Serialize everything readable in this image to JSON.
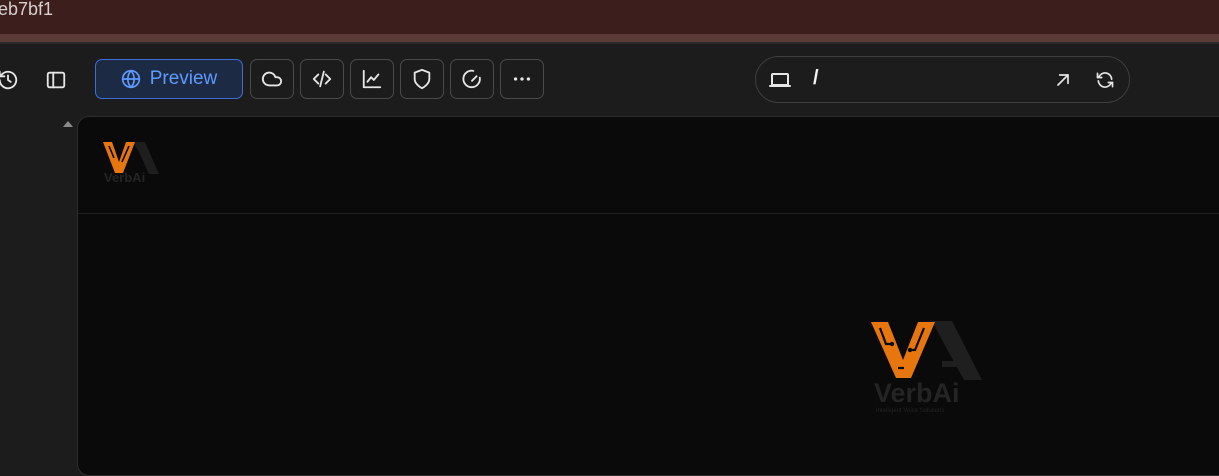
{
  "window": {
    "title_fragment": "eb7bf1"
  },
  "toolbar": {
    "history_icon": "history-icon",
    "sidebar_toggle_icon": "sidebar-toggle-icon",
    "preview_label": "Preview",
    "preview_icon": "globe-icon",
    "buttons": [
      {
        "name": "cloud-button",
        "icon": "cloud-icon"
      },
      {
        "name": "code-button",
        "icon": "code-icon"
      },
      {
        "name": "analytics-button",
        "icon": "chart-line-icon"
      },
      {
        "name": "security-button",
        "icon": "shield-icon"
      },
      {
        "name": "speed-button",
        "icon": "gauge-icon"
      },
      {
        "name": "more-button",
        "icon": "more-horizontal-icon"
      }
    ]
  },
  "address_bar": {
    "device_icon": "laptop-icon",
    "path": "/",
    "open_external_icon": "arrow-up-right-icon",
    "refresh_icon": "refresh-icon"
  },
  "preview": {
    "brand_name": "VerbAi",
    "tagline": "Intelligent Voice Solutions",
    "colors": {
      "accent": "#e8760f",
      "background": "#0a0a0b"
    }
  }
}
